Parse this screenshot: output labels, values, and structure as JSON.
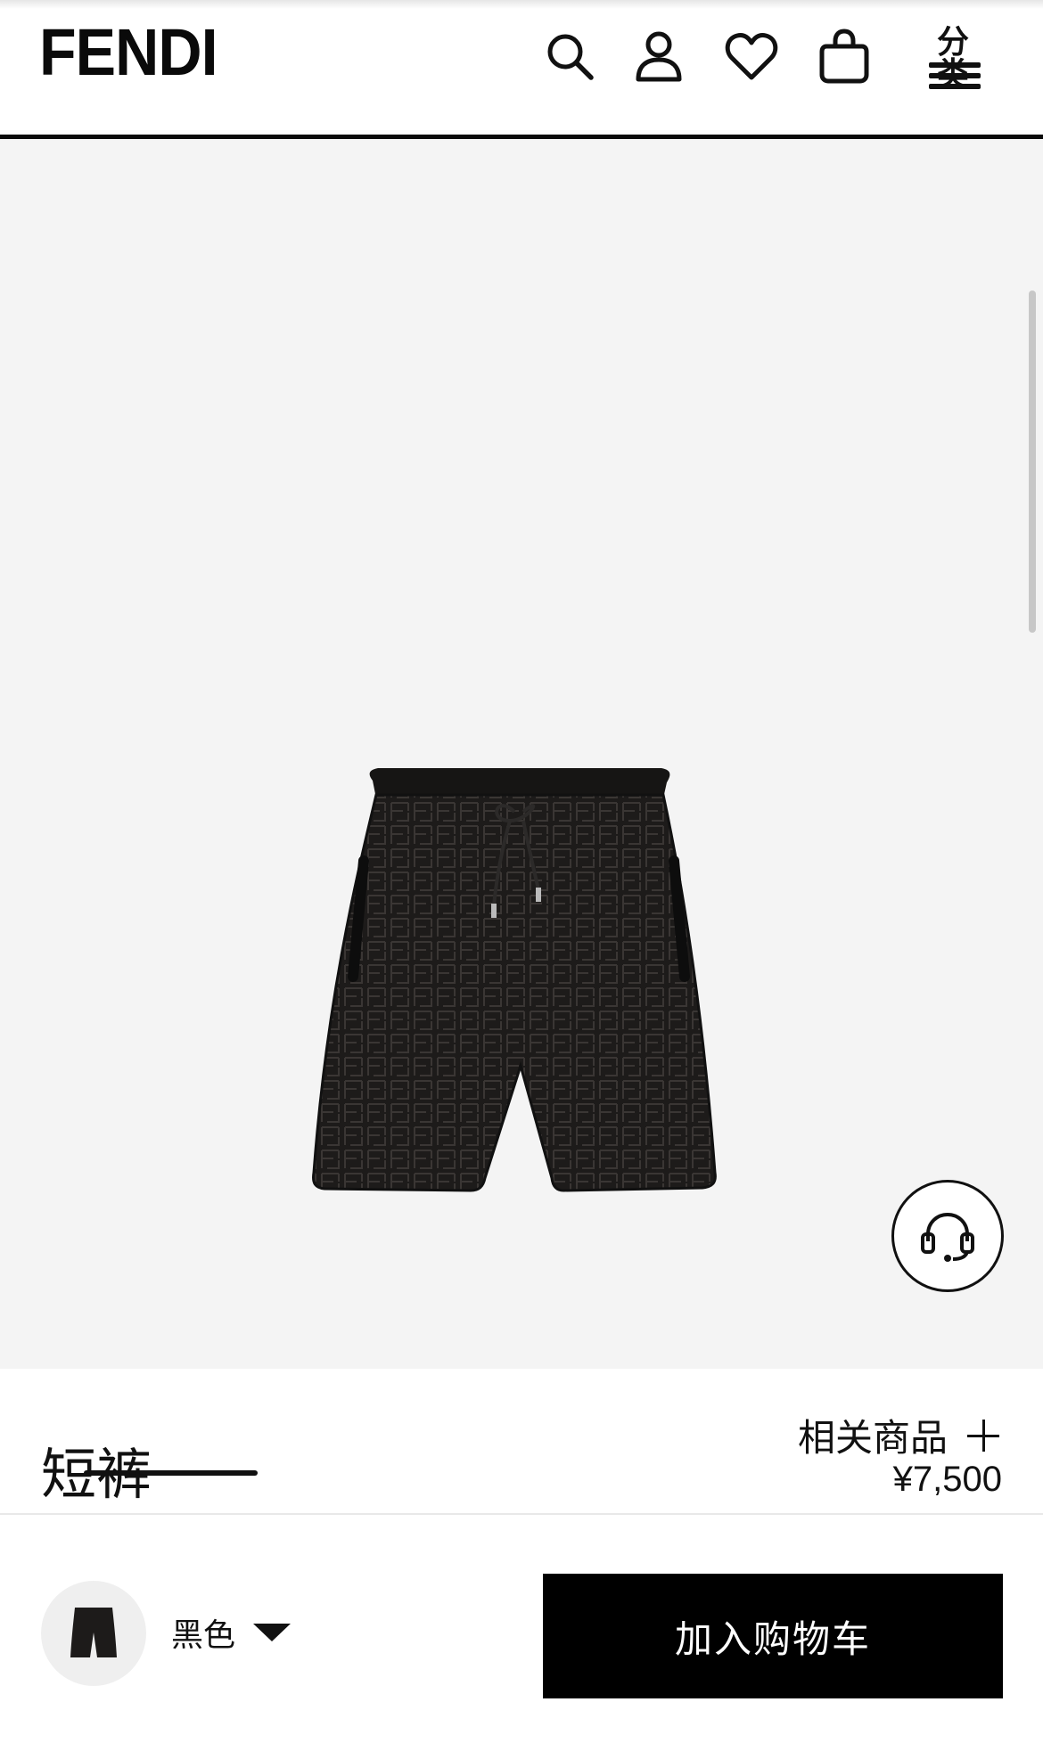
{
  "header": {
    "logo": "FENDI",
    "icons": [
      "search-icon",
      "account-icon",
      "wishlist-heart-icon",
      "shopping-bag-icon"
    ],
    "menu_label": "分类"
  },
  "gallery": {
    "image_description": "black FF monogram velvet shorts",
    "related_label": "相关商品",
    "slide_progress": [
      0.63,
      0,
      0
    ],
    "active_slide": 1,
    "slide_count": 3
  },
  "product": {
    "name": "短裤",
    "price": "¥7,500"
  },
  "purchase": {
    "color": "黑色",
    "add_to_cart_label": "加入购物车"
  },
  "colors": {
    "accent": "#000000",
    "gallery_bg": "#f4f4f4"
  }
}
